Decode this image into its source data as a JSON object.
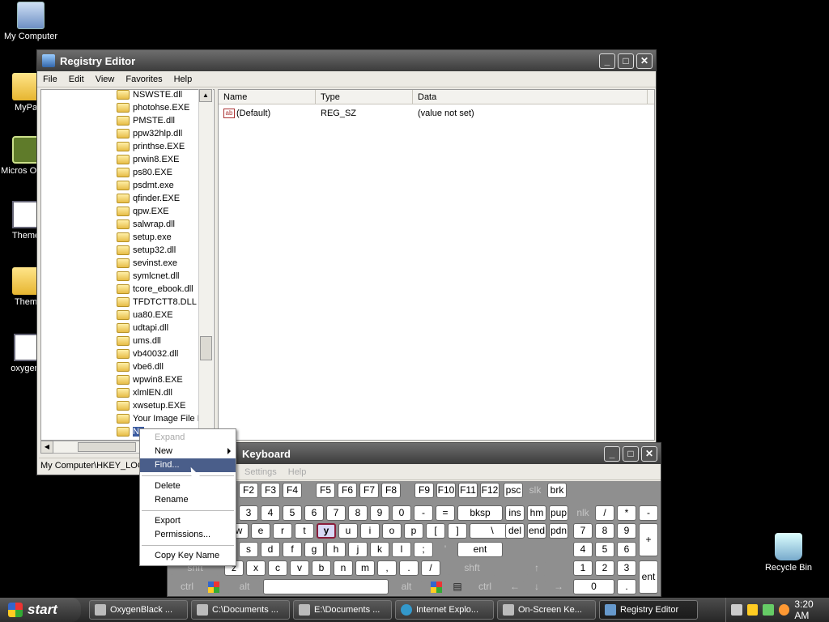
{
  "desktop": {
    "icons": [
      {
        "label": "My Computer"
      },
      {
        "label": "MyPa"
      },
      {
        "label": "Micros Outlo"
      },
      {
        "label": "Theme"
      },
      {
        "label": "Them"
      },
      {
        "label": "oxygenb"
      },
      {
        "label": "Recycle Bin"
      }
    ]
  },
  "regedit": {
    "title": "Registry Editor",
    "menu": [
      "File",
      "Edit",
      "View",
      "Favorites",
      "Help"
    ],
    "tree_items": [
      "NSWSTE.dll",
      "photohse.EXE",
      "PMSTE.dll",
      "ppw32hlp.dll",
      "printhse.EXE",
      "prwin8.EXE",
      "ps80.EXE",
      "psdmt.exe",
      "qfinder.EXE",
      "qpw.EXE",
      "salwrap.dll",
      "setup.exe",
      "setup32.dll",
      "sevinst.exe",
      "symlcnet.dll",
      "tcore_ebook.dll",
      "TFDTCTT8.DLL",
      "ua80.EXE",
      "udtapi.dll",
      "ums.dll",
      "vb40032.dll",
      "vbe6.dll",
      "wpwin8.EXE",
      "xlmlEN.dll",
      "xwsetup.EXE",
      "Your Image File N",
      "Ne"
    ],
    "columns": [
      "Name",
      "Type",
      "Data"
    ],
    "rows": [
      {
        "name": "(Default)",
        "type": "REG_SZ",
        "data": "(value not set)"
      }
    ],
    "status": "My Computer\\HKEY_LOCA"
  },
  "context_menu": {
    "items": [
      "Expand",
      "New",
      "Find...",
      "Delete",
      "Rename",
      "Export",
      "Permissions...",
      "Copy Key Name"
    ]
  },
  "keyboard": {
    "title": "Keyboard",
    "menu": [
      "Settings",
      "Help"
    ],
    "row1": [
      "F2",
      "F3",
      "F4",
      "F5",
      "F6",
      "F7",
      "F8",
      "F9",
      "F10",
      "F11",
      "F12",
      "psc",
      "slk",
      "brk"
    ],
    "row2": [
      "3",
      "4",
      "5",
      "6",
      "7",
      "8",
      "9",
      "0",
      "-",
      "=",
      "bksp",
      "ins",
      "hm",
      "pup",
      "nlk",
      "/",
      "*",
      "-"
    ],
    "row3": [
      "w",
      "e",
      "r",
      "t",
      "y",
      "u",
      "i",
      "o",
      "p",
      "[",
      "]",
      "\\",
      "del",
      "end",
      "pdn",
      "7",
      "8",
      "9",
      "+"
    ],
    "row4": [
      "s",
      "d",
      "f",
      "g",
      "h",
      "j",
      "k",
      "l",
      ";",
      "'",
      "ent",
      "4",
      "5",
      "6"
    ],
    "row5": [
      "shft",
      "z",
      "x",
      "c",
      "v",
      "b",
      "n",
      "m",
      ",",
      ".",
      "/",
      "shft",
      "1",
      "2",
      "3",
      "ent"
    ],
    "row6": [
      "ctrl",
      "alt",
      "alt",
      "ctrl",
      "0",
      "."
    ]
  },
  "taskbar": {
    "start": "start",
    "tasks": [
      "OxygenBlack ...",
      "C:\\Documents ...",
      "E:\\Documents ...",
      "Internet Explo...",
      "On-Screen Ke...",
      "Registry Editor"
    ],
    "clock": "3:20 AM"
  },
  "colors": {
    "desktop_bg": "#000000",
    "titlebar": "#4a4a4a",
    "selection": "#4a5e8a"
  }
}
